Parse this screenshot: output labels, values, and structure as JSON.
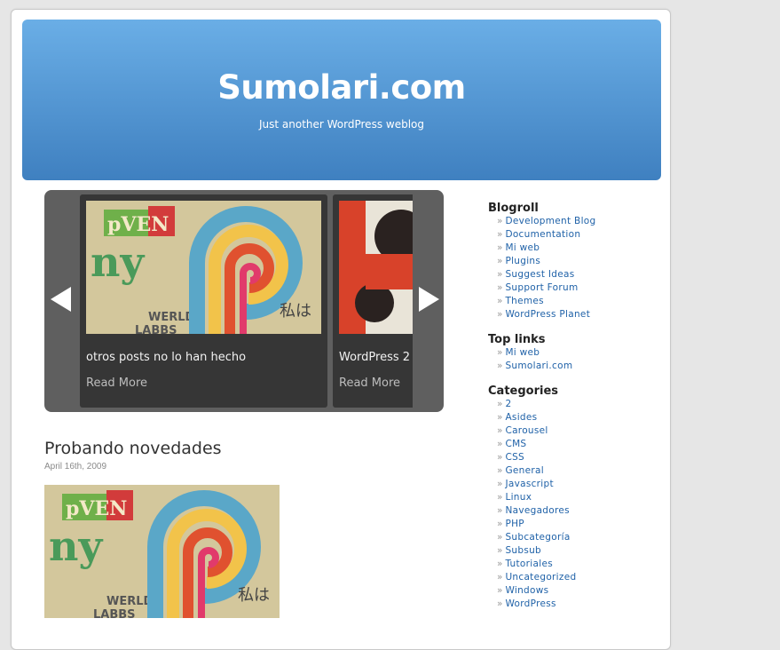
{
  "header": {
    "title": "Sumolari.com",
    "tagline": "Just another WordPress weblog"
  },
  "carousel": {
    "slides": [
      {
        "title": "otros posts no lo han hecho",
        "more": "Read More"
      },
      {
        "title": "WordPress 2",
        "more": "Read More"
      }
    ]
  },
  "post": {
    "title": "Probando novedades",
    "date": "April 16th, 2009"
  },
  "sidebar": {
    "blogroll": {
      "title": "Blogroll",
      "items": [
        "Development Blog",
        "Documentation",
        "Mi web",
        "Plugins",
        "Suggest Ideas",
        "Support Forum",
        "Themes",
        "WordPress Planet"
      ]
    },
    "toplinks": {
      "title": "Top links",
      "items": [
        "Mi web",
        "Sumolari.com"
      ]
    },
    "categories": {
      "title": "Categories",
      "items": [
        "2",
        "Asides",
        "Carousel",
        "CMS",
        "CSS",
        "General",
        "Javascript",
        "Linux",
        "Navegadores",
        "PHP",
        "Subcategoría",
        "Subsub",
        "Tutoriales",
        "Uncategorized",
        "Windows",
        "WordPress"
      ]
    }
  },
  "icons": {
    "prev": "left-triangle-arrow",
    "next": "right-triangle-arrow",
    "bullet": "»"
  },
  "colors": {
    "header_top": "#6aaee6",
    "header_bottom": "#3f80c0",
    "link": "#2062a8",
    "carousel_bg": "#5f5f5f",
    "slide_bg": "#363636"
  }
}
